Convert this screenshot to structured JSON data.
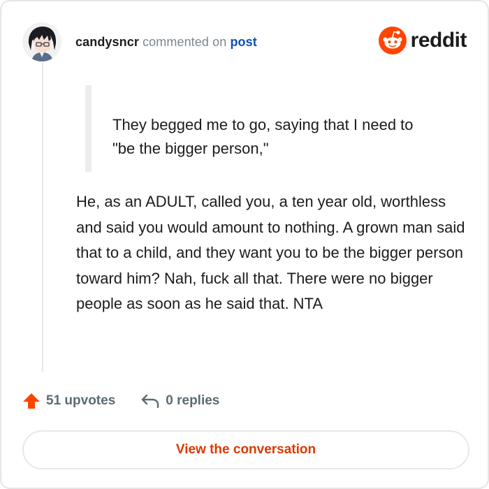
{
  "header": {
    "username": "candysncr",
    "action_text": "commented on",
    "post_link_label": "post",
    "brand_name": "reddit"
  },
  "quote": {
    "text": "They begged me to go, saying that I need to \"be the bigger person,\""
  },
  "comment": {
    "body": "He, as an ADULT, called you, a ten year old, worthless and said you would amount to nothing. A grown man said that to a child, and they want you to be the bigger person toward him? Nah, fuck all that. There were no bigger people as soon as he said that. NTA"
  },
  "stats": {
    "upvotes_label": "51 upvotes",
    "replies_label": "0 replies"
  },
  "cta": {
    "label": "View the conversation"
  },
  "colors": {
    "brand_orange": "#ff4500",
    "upvote_orange": "#ff4500",
    "link_blue": "#0b4fb4",
    "cta_text": "#d93a00"
  },
  "icons": {
    "avatar": "user-avatar",
    "brand": "reddit-logo-icon",
    "upvote": "upvote-arrow-icon",
    "reply": "reply-arrow-icon"
  }
}
